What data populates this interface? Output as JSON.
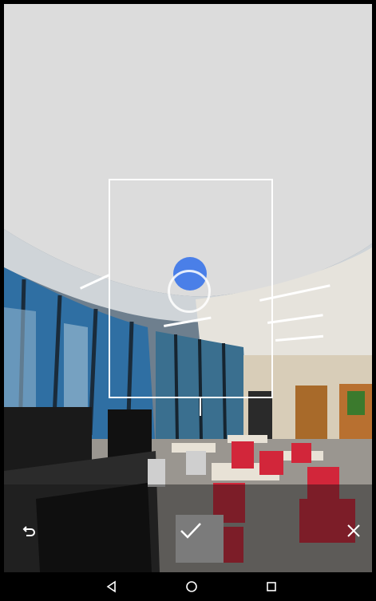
{
  "app": {
    "screen": "panorama-capture"
  },
  "capture": {
    "hint_shown": false
  },
  "actions": {
    "undo_icon": "undo-icon",
    "confirm_icon": "checkmark-icon",
    "cancel_icon": "close-icon"
  },
  "navigation": {
    "back_icon": "back-triangle-icon",
    "home_icon": "home-circle-icon",
    "recents_icon": "recents-square-icon"
  },
  "colors": {
    "sky_gray": "#dcdcdc",
    "target_blue": "#4a7fe8",
    "frame_white": "#ffffff",
    "nav_black": "#000000"
  }
}
